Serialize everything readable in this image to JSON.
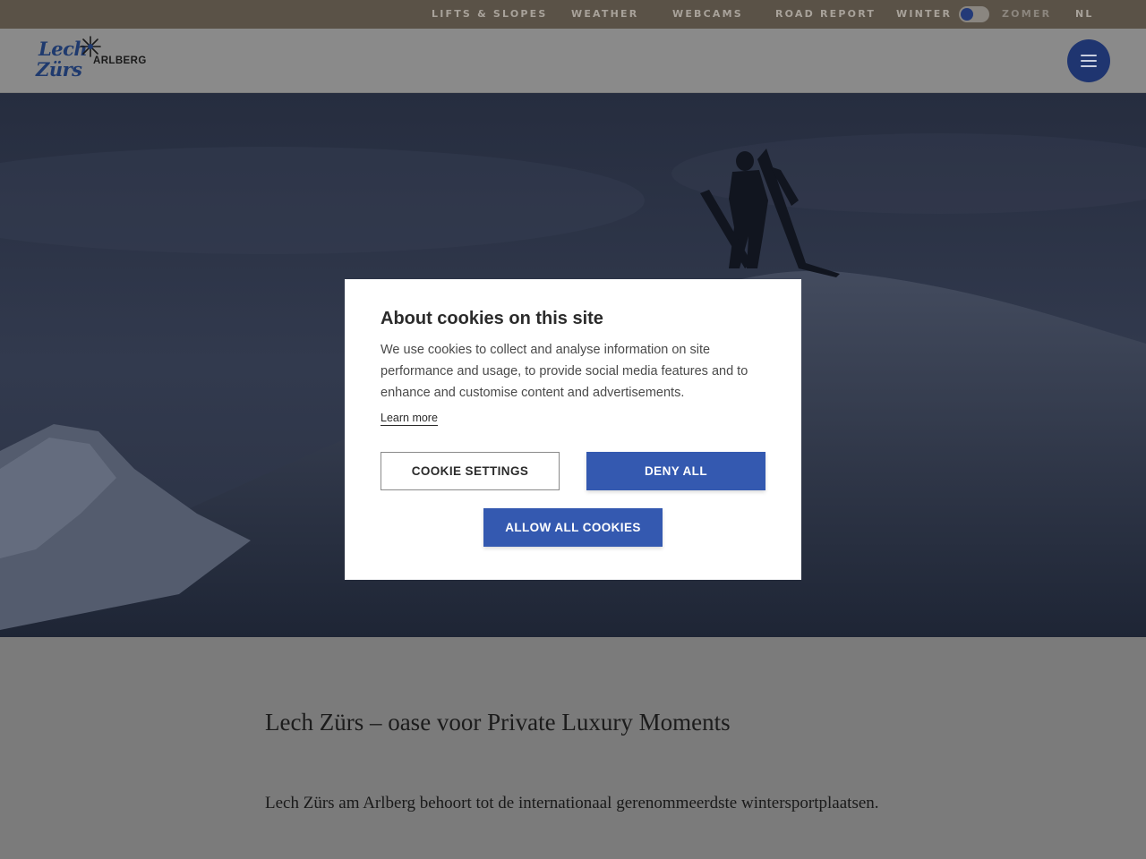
{
  "topbar": {
    "links": [
      "LIFTS & SLOPES",
      "WEATHER",
      "WEBCAMS",
      "ROAD REPORT"
    ],
    "season_left": "WINTER",
    "season_right": "ZOMER",
    "language": "NL"
  },
  "header": {
    "logo_line1": "Lech",
    "logo_line2": "Zürs",
    "logo_sub": "ARLBERG",
    "menu_icon": "hamburger-icon"
  },
  "cookie_modal": {
    "title": "About cookies on this site",
    "body": "We use cookies to collect and analyse information on site performance and usage, to provide social media features and to enhance and customise content and advertisements.",
    "learn_more": "Learn more",
    "settings_label": "COOKIE SETTINGS",
    "deny_label": "DENY ALL",
    "allow_label": "ALLOW ALL COOKIES"
  },
  "content": {
    "heading": "Lech Zürs – oase voor Private Luxury Moments",
    "paragraph": "Lech Zürs am Arlberg behoort tot de internationaal gerenommeerdste wintersportplaatsen."
  },
  "colors": {
    "brand_blue": "#3459b0",
    "topbar_bg": "#5a5247",
    "menu_button": "#1f3570"
  }
}
